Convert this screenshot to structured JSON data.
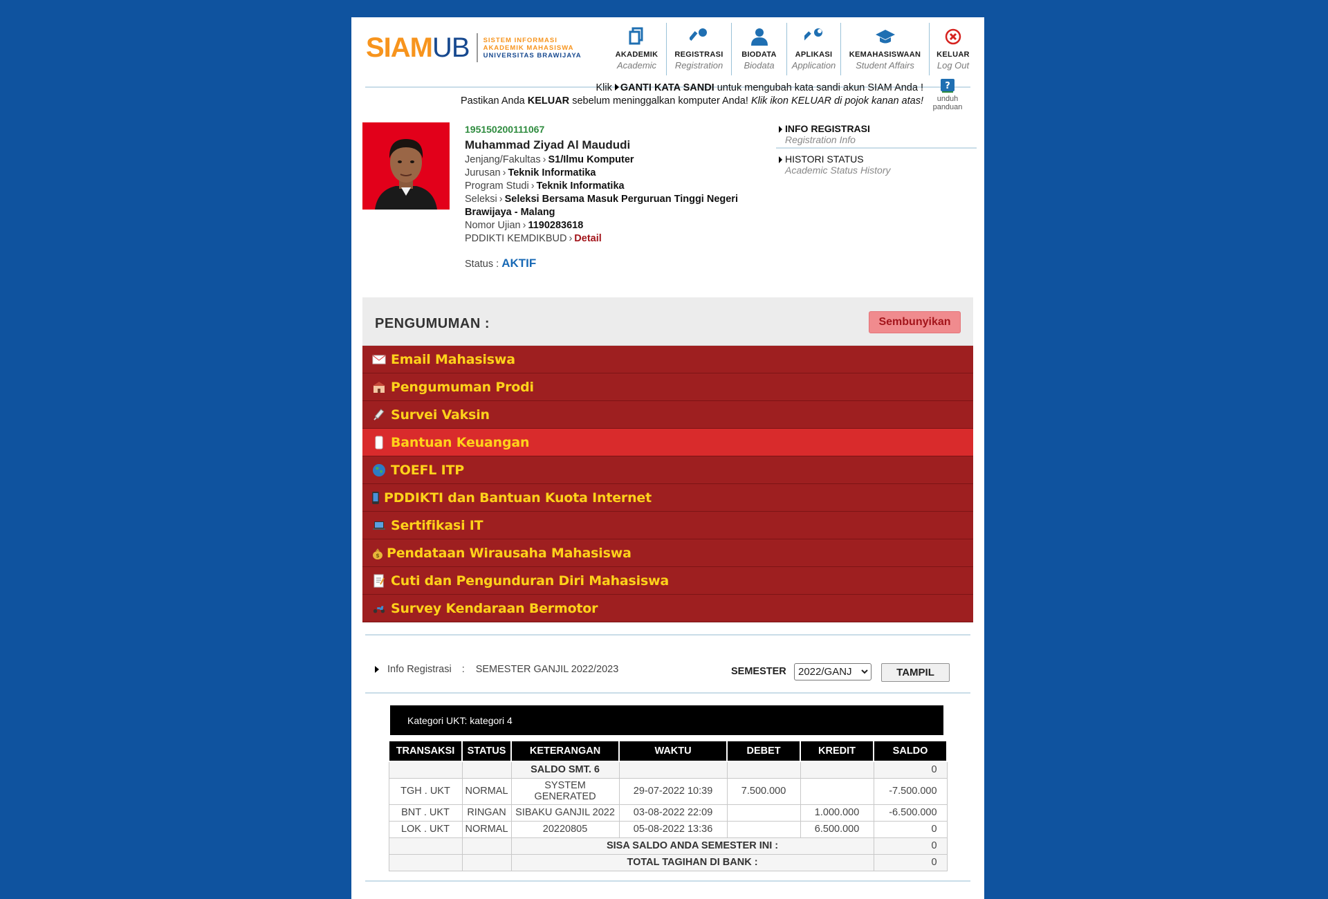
{
  "logo": {
    "siam": "SIAM",
    "ub": "UB",
    "line1": "SISTEM INFORMASI",
    "line2": "AKADEMIK MAHASISWA",
    "line3": "UNIVERSITAS BRAWIJAYA"
  },
  "nav": [
    {
      "label": "AKADEMIK",
      "sub": "Academic",
      "icon": "document-icon"
    },
    {
      "label": "REGISTRASI",
      "sub": "Registration",
      "icon": "key-icon"
    },
    {
      "label": "BIODATA",
      "sub": "Biodata",
      "icon": "person-icon"
    },
    {
      "label": "APLIKASI",
      "sub": "Application",
      "icon": "wrench-icon"
    },
    {
      "label": "KEMAHASISWAAN",
      "sub": "Student Affairs",
      "icon": "graduation-cap-icon"
    },
    {
      "label": "KELUAR",
      "sub": "Log Out",
      "icon": "close-circle-icon"
    }
  ],
  "notice": {
    "l1_a": "Klik",
    "l1_b": "GANTI KATA SANDI",
    "l1_c": "untuk mengubah kata sandi akun SIAM Anda !",
    "l2_a": "Pastikan Anda",
    "l2_b": "KELUAR",
    "l2_c": "sebelum meninggalkan komputer Anda!",
    "l2_d": "Klik ikon KELUAR di pojok kanan atas!",
    "guide_1": "unduh",
    "guide_2": "panduan"
  },
  "profile": {
    "nim": "195150200111067",
    "name": "Muhammad Ziyad Al Maududi",
    "jenjang_label": "Jenjang/Fakultas",
    "jenjang_value": "S1/Ilmu Komputer",
    "jurusan_label": "Jurusan",
    "jurusan_value": "Teknik Informatika",
    "prodi_label": "Program Studi",
    "prodi_value": "Teknik Informatika",
    "seleksi_label": "Seleksi",
    "seleksi_value": "Seleksi Bersama Masuk Perguruan Tinggi Negeri",
    "seleksi_value2": "Brawijaya - Malang",
    "ujian_label": "Nomor Ujian",
    "ujian_value": "1190283618",
    "pddikti_label": "PDDIKTI KEMDIKBUD",
    "pddikti_link": "Detail",
    "status_label": "Status :",
    "status_value": "AKTIF"
  },
  "reginfo": [
    {
      "title": "INFO REGISTRASI",
      "sub": "Registration Info"
    },
    {
      "title": "HISTORI STATUS",
      "sub": "Academic Status History"
    }
  ],
  "announcements": {
    "title": "PENGUMUMAN :",
    "hide_label": "Sembunyikan",
    "items": [
      {
        "label": "Email Mahasiswa",
        "icon": "envelope-icon"
      },
      {
        "label": "Pengumuman Prodi",
        "icon": "building-icon"
      },
      {
        "label": "Survei Vaksin",
        "icon": "syringe-icon"
      },
      {
        "label": "Bantuan Keuangan",
        "icon": "scroll-icon",
        "active": true
      },
      {
        "label": "TOEFL ITP",
        "icon": "globe-icon"
      },
      {
        "label": "PDDIKTI dan Bantuan Kuota Internet",
        "icon": "phone-icon"
      },
      {
        "label": "Sertifikasi IT",
        "icon": "laptop-icon"
      },
      {
        "label": "Pendataan Wirausaha Mahasiswa",
        "icon": "money-bag-icon"
      },
      {
        "label": "Cuti dan Pengunduran Diri Mahasiswa",
        "icon": "memo-icon"
      },
      {
        "label": "Survey Kendaraan Bermotor",
        "icon": "scooter-icon"
      }
    ]
  },
  "registration": {
    "label": "Info Registrasi",
    "colon": ":",
    "value": "SEMESTER GANJIL 2022/2023",
    "semester_label": "SEMESTER",
    "semester_selected": "2022/GANJ",
    "button": "TAMPIL"
  },
  "ukt": {
    "category": "Kategori UKT: kategori 4",
    "headers": [
      "TRANSAKSI",
      "STATUS",
      "KETERANGAN",
      "WAKTU",
      "DEBET",
      "KREDIT",
      "SALDO"
    ],
    "saldo_label": "SALDO SMT. 6",
    "saldo_value": "0",
    "rows": [
      {
        "transaksi": "TGH . UKT",
        "status": "NORMAL",
        "keterangan": "SYSTEM GENERATED",
        "waktu": "29-07-2022 10:39",
        "debet": "7.500.000",
        "kredit": "",
        "saldo": "-7.500.000"
      },
      {
        "transaksi": "BNT . UKT",
        "status": "RINGAN",
        "keterangan": "SIBAKU GANJIL 2022",
        "waktu": "03-08-2022 22:09",
        "debet": "",
        "kredit": "1.000.000",
        "saldo": "-6.500.000"
      },
      {
        "transaksi": "LOK . UKT",
        "status": "NORMAL",
        "keterangan": "20220805",
        "waktu": "05-08-2022 13:36",
        "debet": "",
        "kredit": "6.500.000",
        "saldo": "0"
      }
    ],
    "sisa_label": "SISA SALDO ANDA SEMESTER INI :",
    "sisa_value": "0",
    "total_label": "TOTAL TAGIHAN DI BANK :",
    "total_value": "0"
  }
}
